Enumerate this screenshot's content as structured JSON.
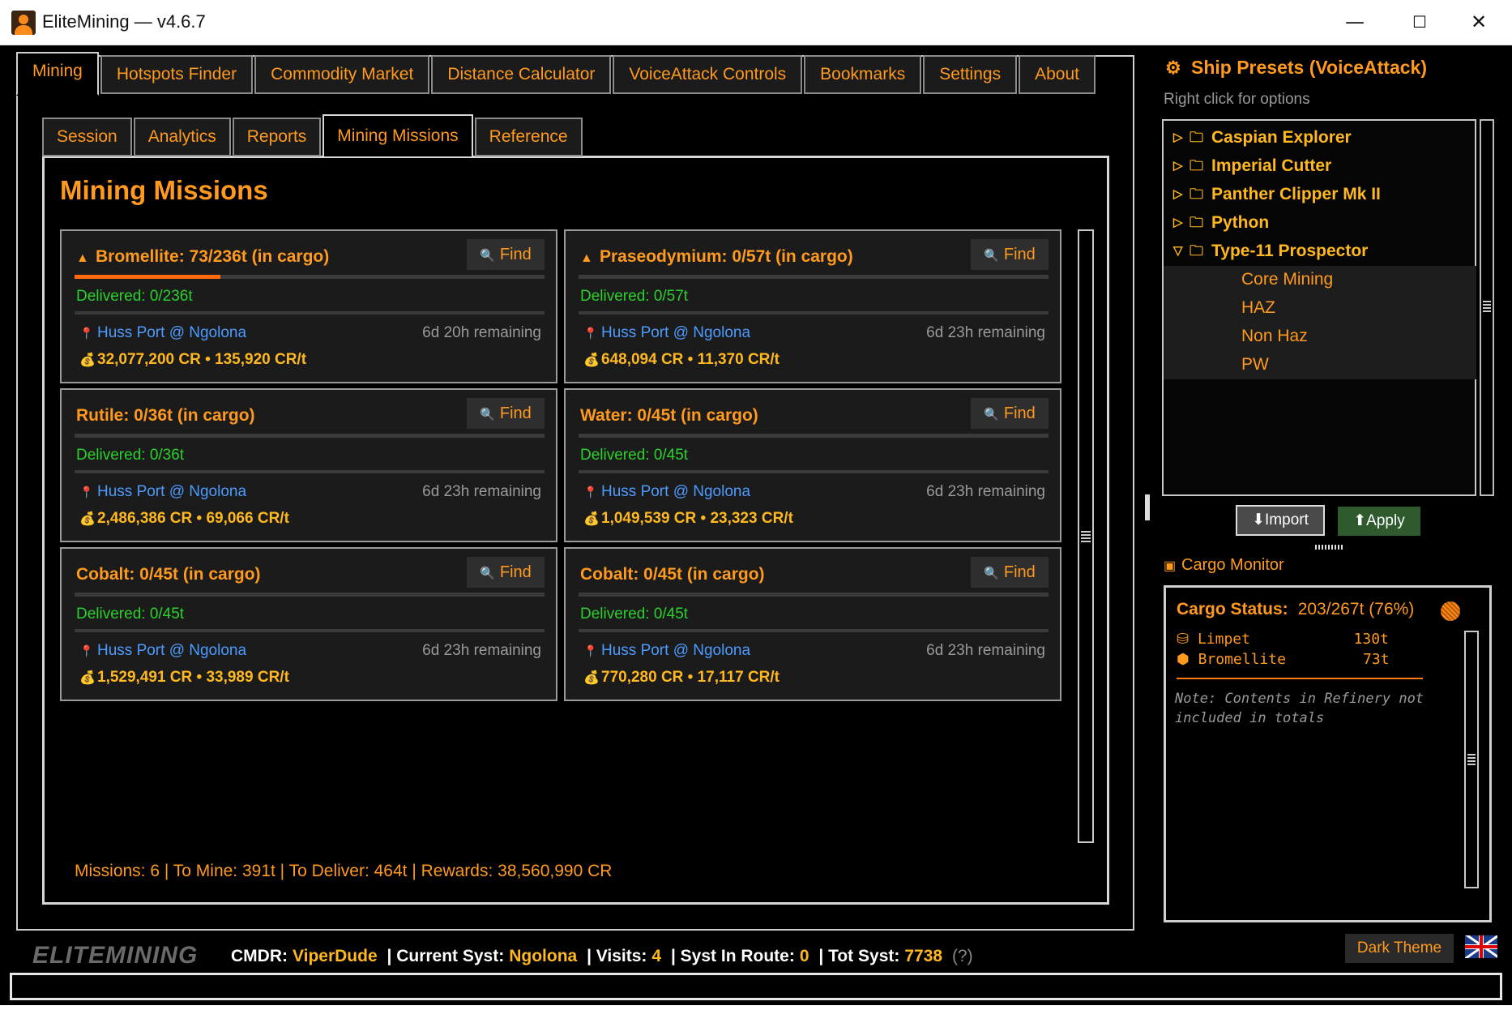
{
  "window": {
    "title": "EliteMining — v4.6.7",
    "minimize": "—",
    "maximize": "☐",
    "close": "✕"
  },
  "main_tabs": [
    "Mining",
    "Hotspots Finder",
    "Commodity Market",
    "Distance Calculator",
    "VoiceAttack Controls",
    "Bookmarks",
    "Settings",
    "About"
  ],
  "sub_tabs": [
    "Session",
    "Analytics",
    "Reports",
    "Mining Missions",
    "Reference"
  ],
  "page_title": "Mining Missions",
  "find_label": "Find",
  "missions": [
    {
      "title": "Bromellite: 73/236t (in cargo)",
      "cargo_progress": 0.31,
      "delivered": "Delivered: 0/236t",
      "location": "Huss Port @ Ngolona",
      "remaining": "6d 20h remaining",
      "reward": "32,077,200 CR  •  135,920 CR/t"
    },
    {
      "title": "Praseodymium: 0/57t (in cargo)",
      "cargo_progress": 0,
      "delivered": "Delivered: 0/57t",
      "location": "Huss Port @ Ngolona",
      "remaining": "6d 23h remaining",
      "reward": "648,094 CR  •  11,370 CR/t"
    },
    {
      "title": "Rutile: 0/36t (in cargo)",
      "cargo_progress": 0,
      "delivered": "Delivered: 0/36t",
      "location": "Huss Port @ Ngolona",
      "remaining": "6d 23h remaining",
      "reward": "2,486,386 CR  •  69,066 CR/t"
    },
    {
      "title": "Water: 0/45t (in cargo)",
      "cargo_progress": 0,
      "delivered": "Delivered: 0/45t",
      "location": "Huss Port @ Ngolona",
      "remaining": "6d 23h remaining",
      "reward": "1,049,539 CR  •  23,323 CR/t"
    },
    {
      "title": "Cobalt: 0/45t (in cargo)",
      "cargo_progress": 0,
      "delivered": "Delivered: 0/45t",
      "location": "Huss Port @ Ngolona",
      "remaining": "6d 23h remaining",
      "reward": "1,529,491 CR  •  33,989 CR/t"
    },
    {
      "title": "Cobalt: 0/45t (in cargo)",
      "cargo_progress": 0,
      "delivered": "Delivered: 0/45t",
      "location": "Huss Port @ Ngolona",
      "remaining": "6d 23h remaining",
      "reward": "770,280 CR  •  17,117 CR/t"
    }
  ],
  "summary": "Missions: 6  |  To Mine: 391t  |  To Deliver: 464t  |  Rewards: 38,560,990 CR",
  "presets": {
    "title": "Ship Presets (VoiceAttack)",
    "hint": "Right click for options",
    "folders": [
      "Caspian Explorer",
      "Imperial Cutter",
      "Panther Clipper Mk II",
      "Python",
      "Type-11 Prospector"
    ],
    "expanded_children": [
      "Core Mining",
      "HAZ",
      "Non Haz",
      "PW"
    ],
    "import_label": "⬇Import",
    "apply_label": "⬆Apply"
  },
  "cargo": {
    "label": "Cargo Monitor",
    "status_key": "Cargo Status:",
    "status_value": "203/267t (76%)",
    "items": [
      {
        "name": "Limpet",
        "amount": "130t"
      },
      {
        "name": "Bromellite",
        "amount": "73t"
      }
    ],
    "note": "Note: Contents in Refinery not included in totals"
  },
  "status_bar": {
    "brand": "ELITEMINING",
    "cmdr_label": "CMDR:",
    "cmdr": "ViperDude",
    "system_label": "| Current Syst:",
    "system": "Ngolona",
    "visits_label": "| Visits:",
    "visits": "4",
    "route_label": "| Syst In Route:",
    "route": "0",
    "total_label": "| Tot Syst:",
    "total": "7738",
    "help": "(?)"
  },
  "theme_button": "Dark Theme",
  "colors": {
    "accent": "#ff9a1f",
    "gold": "#ffb81e",
    "delivered": "#2bd12b",
    "location": "#4d9bff",
    "progress": "#ff6a10"
  }
}
